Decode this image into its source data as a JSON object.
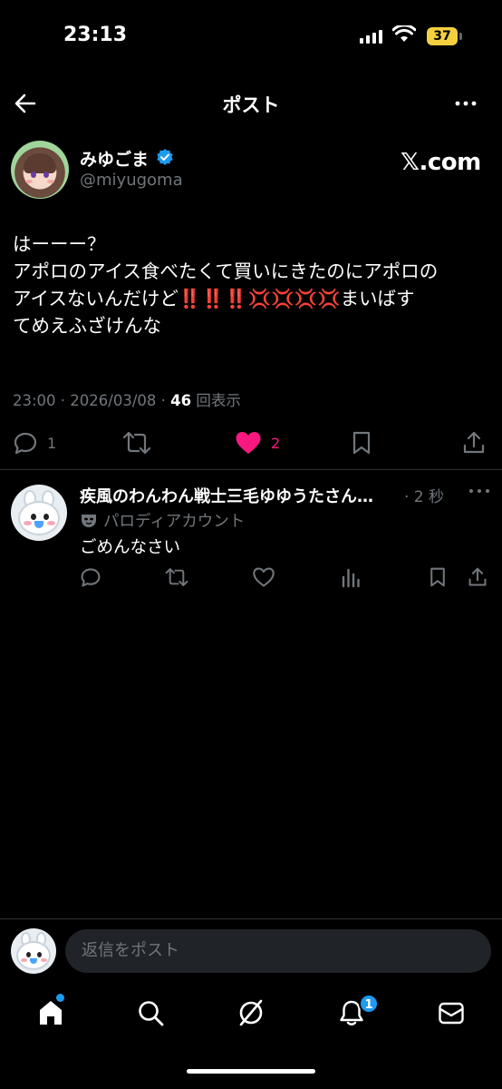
{
  "status_bar": {
    "time": "23:13",
    "battery": "37"
  },
  "header": {
    "title": "ポスト"
  },
  "tweet": {
    "author_name": "みゆごま",
    "author_handle": "@miyugoma",
    "source_badge": "𝕏.com",
    "text_line1": "はーーー？",
    "text_line2": "アポロのアイス食べたくて買いにきたのにアポロの",
    "text_line3_a": "アイスないんだけど",
    "text_line3_emoji": "‼️‼️‼️💢💢💢💢",
    "text_line3_b": "まいばす",
    "text_line4": "てめえふざけんな",
    "timestamp": "23:00 · 2026/03/08 · ",
    "views_count": "46",
    "views_label": " 回表示",
    "reply_count": "1",
    "like_count": "2",
    "liked": true
  },
  "reply": {
    "author_name": "疾風のわんわん戦士三毛ゆゆうたさん…",
    "time": "· 2 秒",
    "label": "パロディアカウント",
    "text": "ごめんなさい"
  },
  "compose": {
    "placeholder": "返信をポスト"
  },
  "nav": {
    "notification_count": "1"
  },
  "colors": {
    "accent": "#1d9bf0",
    "like": "#f91880",
    "muted": "#71767b",
    "battery": "#f4d03f"
  }
}
